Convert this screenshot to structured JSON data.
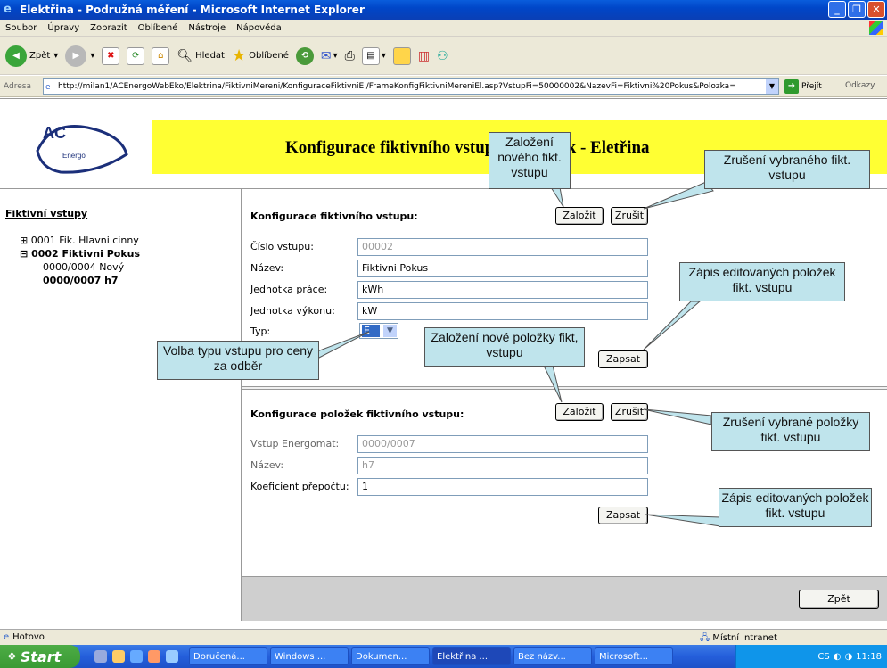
{
  "window": {
    "title": "Elektřina - Podružná měření - Microsoft Internet Explorer"
  },
  "menu": [
    "Soubor",
    "Úpravy",
    "Zobrazit",
    "Oblíbené",
    "Nástroje",
    "Nápověda"
  ],
  "toolbar": {
    "back": "Zpět",
    "search": "Hledat",
    "favorites": "Oblíbené"
  },
  "address": {
    "label": "Adresa",
    "url": "http://milan1/ACEnergoWebEko/Elektrina/FiktivniMereni/KonfiguraceFiktivniEl/FrameKonfigFiktivniMereniEl.asp?VstupFi=50000002&NazevFi=Fiktivni%20Pokus&Polozka=",
    "go": "Přejít",
    "links": "Odkazy"
  },
  "logo": {
    "text": "AC",
    "sub": "Energo"
  },
  "page": {
    "title": "Konfigurace fiktivního vstupu a položek - Eletřina"
  },
  "sidebar": {
    "title": "Fiktivní vstupy",
    "items": [
      {
        "prefix": "⊞",
        "label": "0001 Fik. Hlavni cinny"
      },
      {
        "prefix": "⊟",
        "label": "0002 Fiktivni Pokus"
      },
      {
        "prefix": "",
        "label": "0000/0004 Nový"
      },
      {
        "prefix": "",
        "label": "0000/0007 h7"
      }
    ]
  },
  "input_section": {
    "title": "Konfigurace fiktivního vstupu:",
    "create": "Založit",
    "cancel": "Zrušit",
    "fields": {
      "number": {
        "label": "Číslo vstupu:",
        "value": "00002"
      },
      "name": {
        "label": "Název:",
        "value": "Fiktivni Pokus"
      },
      "work_unit": {
        "label": "Jednotka práce:",
        "value": "kWh"
      },
      "power_unit": {
        "label": "Jednotka výkonu:",
        "value": "kW"
      },
      "type": {
        "label": "Typ:",
        "value": "E"
      }
    },
    "save": "Zapsat"
  },
  "items_section": {
    "title": "Konfigurace položek fiktivního vstupu:",
    "create": "Založit",
    "cancel": "Zrušit",
    "fields": {
      "energomat": {
        "label": "Vstup Energomat:",
        "value": "0000/0007"
      },
      "name": {
        "label": "Název:",
        "value": "h7"
      },
      "coef": {
        "label": "Koeficient přepočtu:",
        "value": "1"
      }
    },
    "save": "Zapsat"
  },
  "back_button": "Zpět",
  "callouts": {
    "create_input": "Založení nového fikt. vstupu",
    "cancel_input": "Zrušení vybraného fikt. vstupu",
    "save_input": "Zápis editovaných položek fikt. vstupu",
    "type_choice": "Volba typu vstupu pro ceny za odběr",
    "create_item": "Založení nové položky fikt, vstupu",
    "cancel_item": "Zrušení vybrané položky fikt. vstupu",
    "save_item": "Zápis editovaných položek fikt. vstupu"
  },
  "status": {
    "left": "Hotovo",
    "zone": "Místní intranet"
  },
  "taskbar": {
    "start": "Start",
    "tasks": [
      "Doručená...",
      "Windows ...",
      "Dokumen...",
      "Elektřina ...",
      "Bez názv...",
      "Microsoft..."
    ],
    "lang": "CS",
    "clock": "11:18"
  },
  "colors": {
    "header_band": "#ffff33",
    "callout_bg": "#bfe4ec",
    "xp_blue": "#0a5ddc"
  }
}
